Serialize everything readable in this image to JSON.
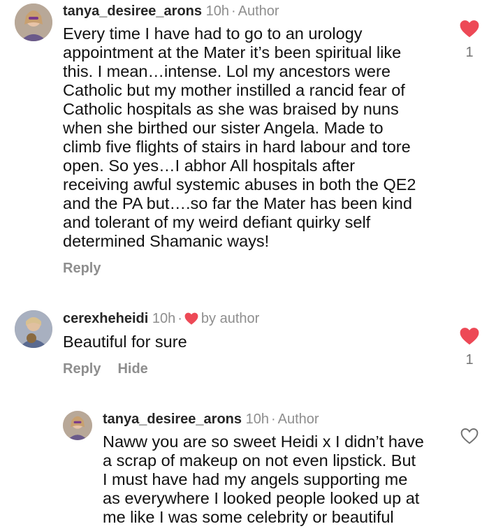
{
  "comments": [
    {
      "username": "tanya_desiree_arons",
      "time": "10h",
      "badge": "Author",
      "lines": [
        "Every time I have had to go to an urology",
        "appointment at the Mater it’s been spiritual like",
        "this.  I mean…intense.  Lol my ancestors were",
        "Catholic but my mother instilled a rancid fear of",
        "Catholic hospitals as she was braised by nuns",
        "when she birthed our sister Angela.  Made to",
        "climb five flights of stairs in hard labour and tore",
        "open.  So yes…I abhor All hospitals after",
        "receiving awful systemic abuses in both the QE2",
        "and the PA but….so far the Mater has been kind",
        "and tolerant of my weird defiant quirky self",
        "determined Shamanic ways!"
      ],
      "reply_label": "Reply",
      "like_count": "1",
      "liked": true
    },
    {
      "username": "cerexheheidi",
      "time": "10h",
      "badge": "by author",
      "lines": [
        "Beautiful for sure"
      ],
      "reply_label": "Reply",
      "hide_label": "Hide",
      "like_count": "1",
      "liked": true
    },
    {
      "username": "tanya_desiree_arons",
      "time": "10h",
      "badge": "Author",
      "lines": [
        "Naww you are so sweet Heidi x I didn’t have",
        "a scrap of makeup on not even lipstick.  But",
        "I must have had my angels supporting me",
        "as everywhere I looked people looked up at",
        "me like I was some celebrity or beautiful"
      ],
      "liked": false
    }
  ],
  "colors": {
    "heart_red": "#ed4956",
    "muted": "#8e8e8e",
    "text": "#111111"
  },
  "icons": {
    "like_filled": "heart-filled-icon",
    "like_outline": "heart-outline-icon",
    "liked_by_author": "heart-mini-icon"
  }
}
